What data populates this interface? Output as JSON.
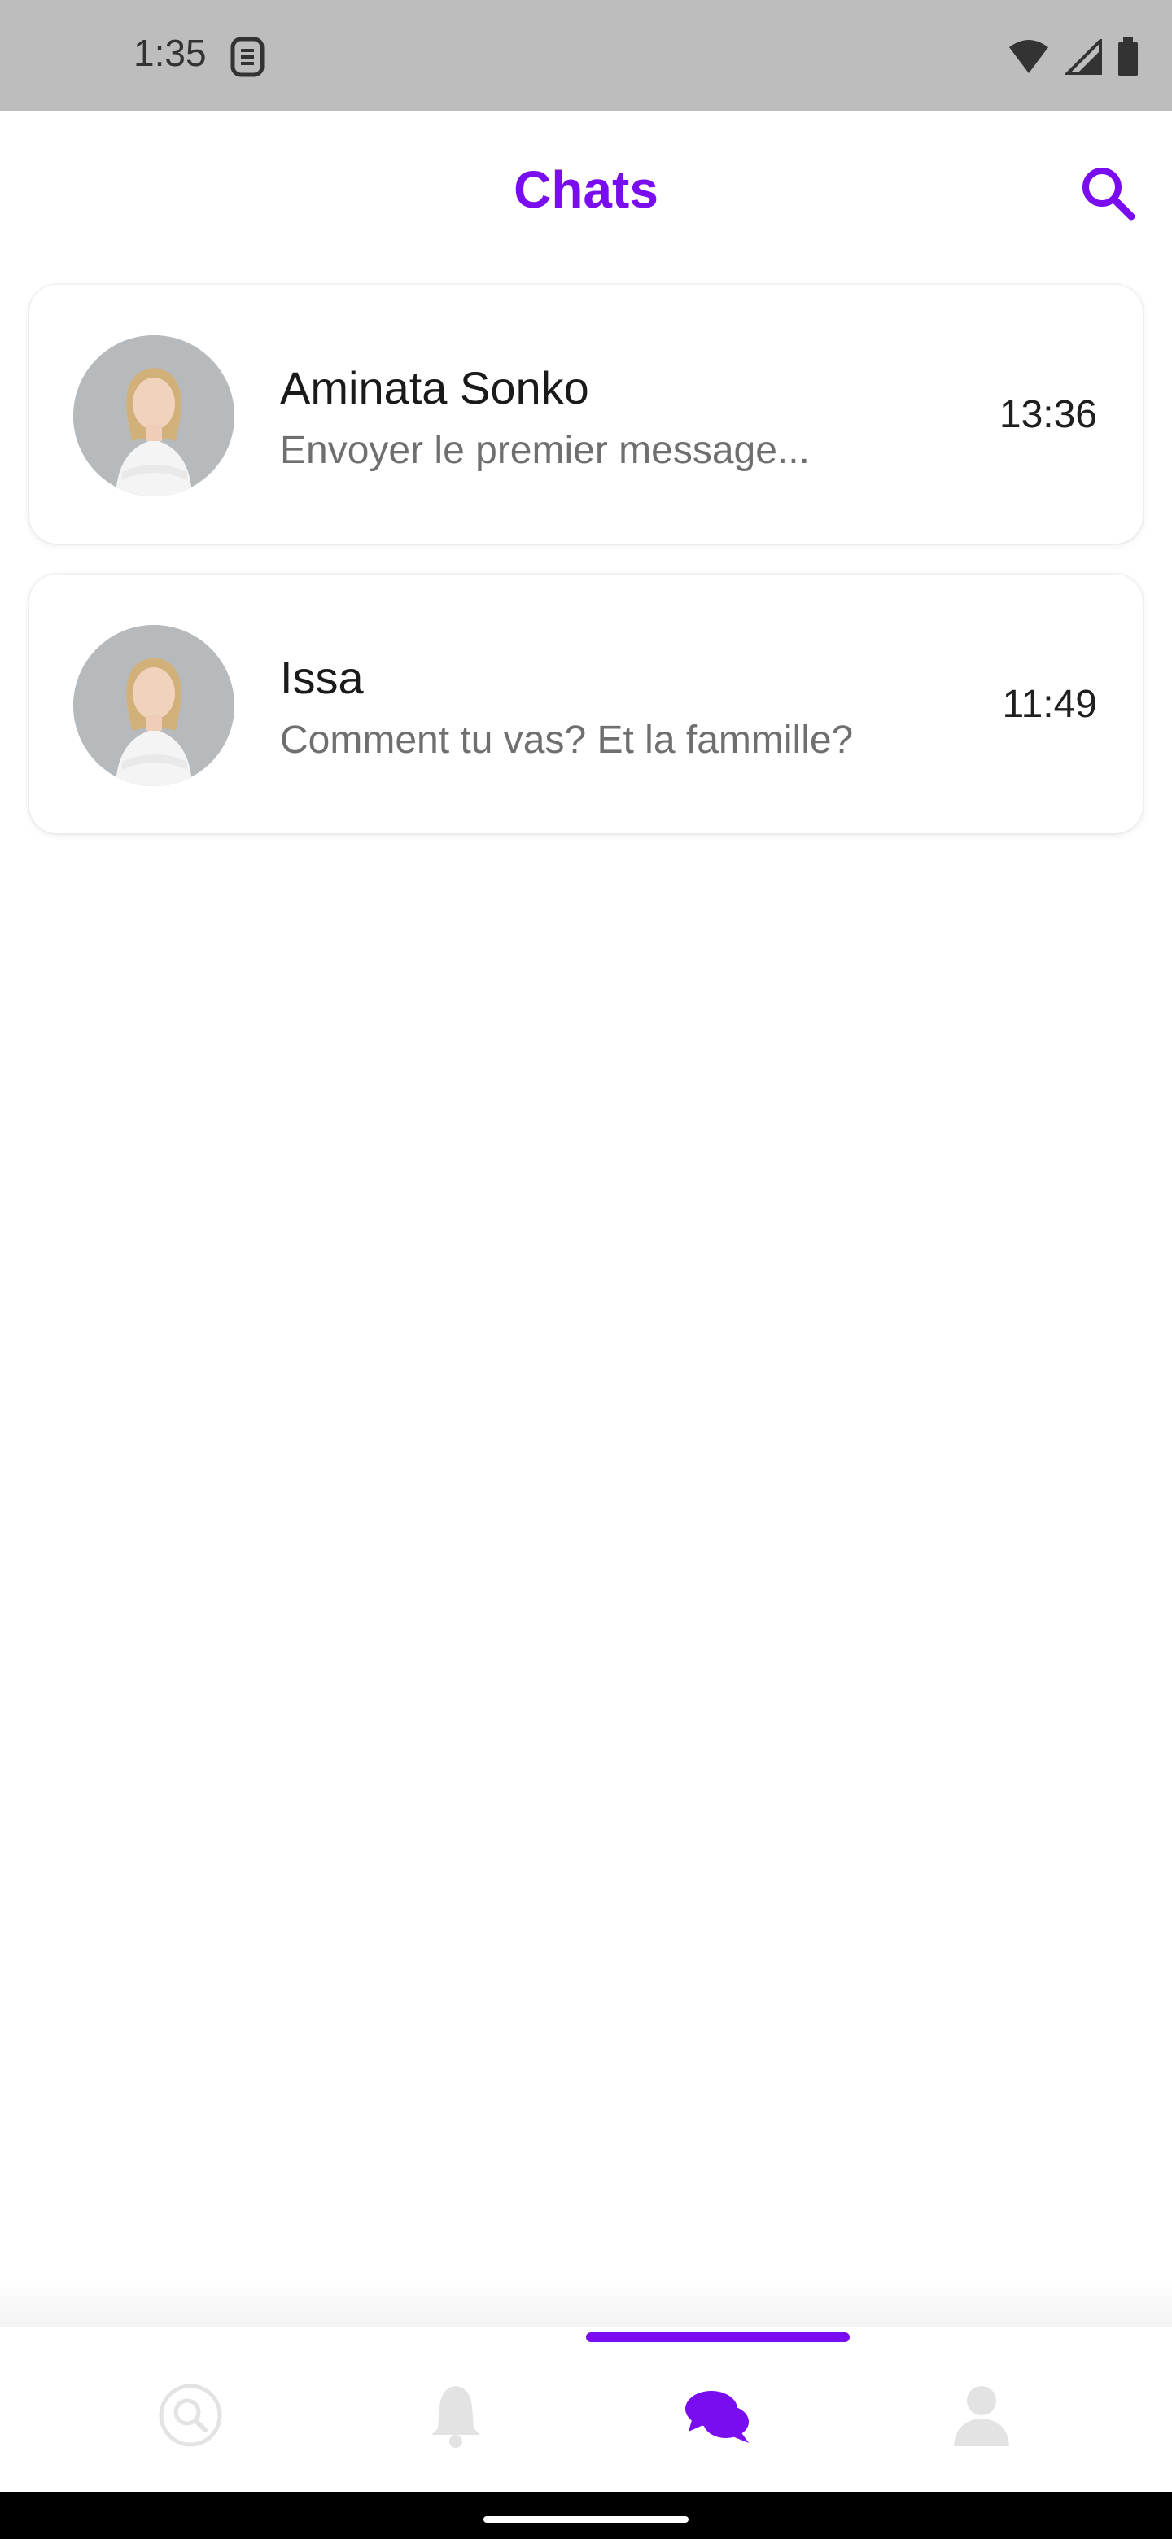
{
  "status_bar": {
    "time": "1:35"
  },
  "header": {
    "title": "Chats"
  },
  "chats": [
    {
      "name": "Aminata Sonko",
      "preview": "Envoyer le premier message...",
      "time": "13:36"
    },
    {
      "name": "Issa",
      "preview": "Comment tu vas? Et la fammille?",
      "time": "11:49"
    }
  ],
  "bottom_nav": {
    "items": [
      "discover-icon",
      "bell-icon",
      "chat-bubbles-icon",
      "person-icon"
    ],
    "active_index": 2
  },
  "colors": {
    "accent": "#7a0cf0",
    "inactive_icon": "#e3e3e3",
    "status_bar": "#bdbdbd"
  }
}
